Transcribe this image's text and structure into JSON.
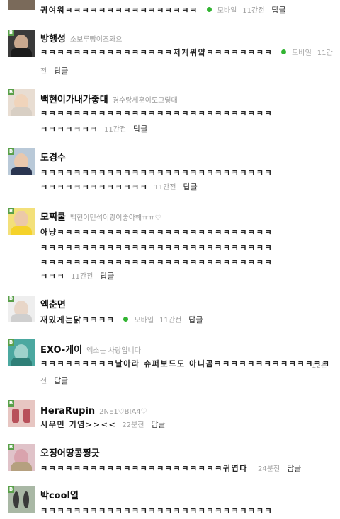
{
  "comments": [
    {
      "line1": "귀여워ㅋㅋㅋㅋㅋㅋㅋㅋㅋㅋㅋㅋㅋㅋㅋㅋ",
      "mobile": "모바일",
      "time": "11간전",
      "reply": "답글"
    },
    {
      "nick": "방행성",
      "intro": "소보루빵이조와요",
      "line1": "ㅋㅋㅋㅋㅋㅋㅋㅋㅋㅋㅋㅋㅋㅋㅋㅋ저게뭐얔ㅋㅋㅋㅋㅋㅋㅋㅋ",
      "mobile": "모바일",
      "time_a": "11간",
      "time_b": "전",
      "reply": "답글"
    },
    {
      "nick": "백현이가내가좋대",
      "intro": "경수랑세훈이도그렇대",
      "line1": "ㅋㅋㅋㅋㅋㅋㅋㅋㅋㅋㅋㅋㅋㅋㅋㅋㅋㅋㅋㅋㅋㅋㅋㅋㅋㅋㅋㅋ",
      "line2": "ㅋㅋㅋㅋㅋㅋㅋ",
      "time": "11간전",
      "reply": "답글"
    },
    {
      "nick": "도경수",
      "line1": "ㅋㅋㅋㅋㅋㅋㅋㅋㅋㅋㅋㅋㅋㅋㅋㅋㅋㅋㅋㅋㅋㅋㅋㅋㅋㅋㅋㅋ",
      "line2": "ㅋㅋㅋㅋㅋㅋㅋㅋㅋㅋㅋㅋㅋ",
      "time": "11간전",
      "reply": "답글"
    },
    {
      "nick": "모찌쿨",
      "intro": "백현이민석이랑이좋아해ㅠㅠ♡",
      "line1": "아냥ㅋㅋㅋㅋㅋㅋㅋㅋㅋㅋㅋㅋㅋㅋㅋㅋㅋㅋㅋㅋㅋㅋㅋㅋㅋㅋ",
      "line2": "ㅋㅋㅋㅋㅋㅋㅋㅋㅋㅋㅋㅋㅋㅋㅋㅋㅋㅋㅋㅋㅋㅋㅋㅋㅋㅋㅋㅋ",
      "line3": "ㅋㅋㅋㅋㅋㅋㅋㅋㅋㅋㅋㅋㅋㅋㅋㅋㅋㅋㅋㅋㅋㅋㅋㅋㅋㅋㅋㅋ",
      "line4": "ㅋㅋㅋ",
      "time": "11간전",
      "reply": "답글"
    },
    {
      "nick": "엑춘면",
      "line1": "재밌게는닭ㅋㅋㅋㅋ",
      "mobile": "모바일",
      "time": "11간전",
      "reply": "답글"
    },
    {
      "nick": "EXO-게이",
      "intro": "엑소는 사랑입니다",
      "line1": "ㅋㅋㅋㅋㅋㅋㅋㅋㅋ날아라 슈퍼보드도 아니곰ㅋㅋㅋㅋㅋㅋㅋㅋㅋㅋㅋㅋㅋㅋ",
      "time_a": "12분",
      "time_b": "전",
      "reply": "답글"
    },
    {
      "nick": "HeraRupin",
      "intro": "2NE1♡BIA4♡",
      "line1": "시우민 기염>><<",
      "time": "22분전",
      "reply": "답글"
    },
    {
      "nick": "오징어땅콩찡긋",
      "line1": "ㅋㅋㅋㅋㅋㅋㅋㅋㅋㅋㅋㅋㅋㅋㅋㅋㅋㅋㅋㅋㅋㅋ귀엽다",
      "time": "24분전",
      "reply": "답글"
    },
    {
      "nick": "박cool열",
      "line1": "ㅋㅋㅋㅋㅋㅋㅋㅋㅋㅋㅋㅋㅋㅋㅋㅋㅋㅋㅋㅋㅋㅋㅋㅋㅋㅋㅋㅋ"
    }
  ],
  "level_badge": "B"
}
